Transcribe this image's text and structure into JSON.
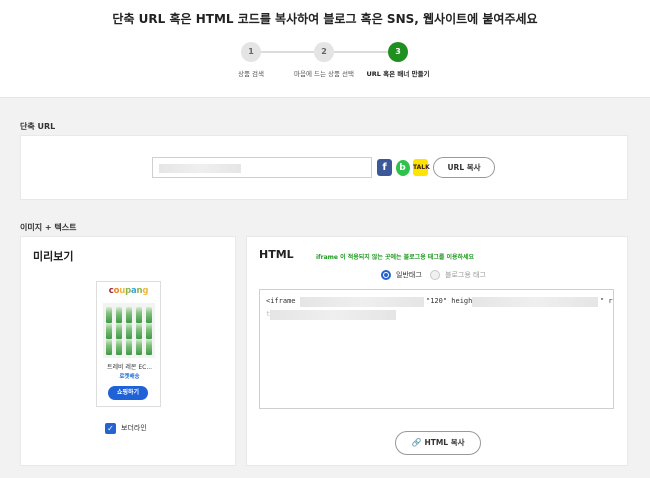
{
  "header": {
    "headline": "단축 URL 혹은 HTML 코드를 복사하여 블로그 혹은 SNS, 웹사이트에 붙여주세요",
    "steps": [
      {
        "num": "1",
        "label": "상품 검색"
      },
      {
        "num": "2",
        "label": "마음에 드는 상품 선택"
      },
      {
        "num": "3",
        "label": "URL 혹은 배너 만들기"
      }
    ]
  },
  "short_url": {
    "section_title": "단축 URL",
    "copy_label": "URL 복사",
    "sns": [
      "facebook-icon",
      "band-icon",
      "kakaotalk-icon"
    ],
    "sns_glyphs": {
      "facebook": "f",
      "band": "b",
      "kakao": "TALK"
    }
  },
  "image_text": {
    "section_title": "이미지 + 텍스트",
    "preview": {
      "title": "미리보기",
      "brand": [
        "c",
        "o",
        "u",
        "p",
        "a",
        "n",
        "g"
      ],
      "product_name": "트레비 레몬 EC...",
      "rocket_label": "로켓배송",
      "shop_button": "쇼핑하기",
      "border_checkbox_label": "보더라인",
      "border_checked": true,
      "check_glyph": "✓"
    },
    "html": {
      "title": "HTML",
      "notice": "iframe 이 적용되지 않는 곳에는 블로그용 태그를 이용하세요",
      "radio_general": "일반태그",
      "radio_blog": "블로그용 태그",
      "selected": "일반태그",
      "code_prefix": "<iframe s",
      "code_mid": "\"120\" height=",
      "code_end": "\" r",
      "code_line2": "t",
      "copy_label": "HTML 복사"
    }
  },
  "colors": {
    "accent_green": "#1f8f1f",
    "accent_blue": "#2563d0",
    "notice_green": "#1e9a1e"
  }
}
